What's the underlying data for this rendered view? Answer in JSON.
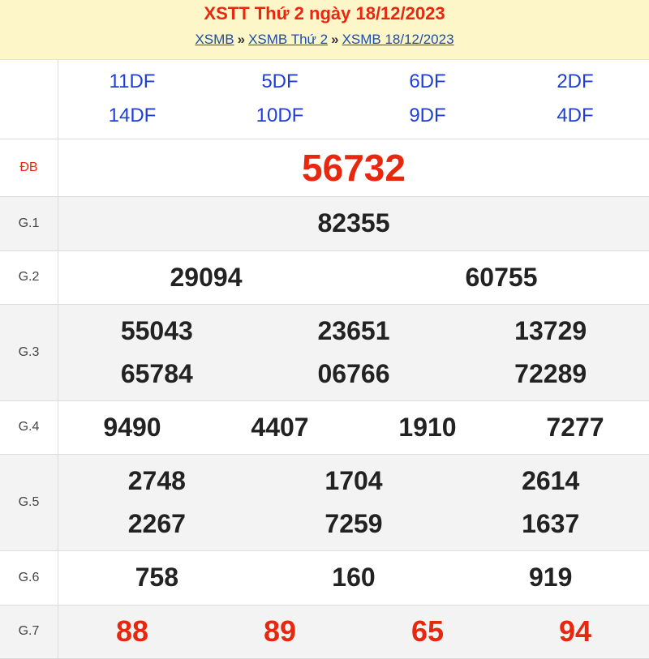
{
  "header": {
    "title": "XSTT Thứ 2 ngày 18/12/2023",
    "breadcrumb": [
      "XSMB",
      "XSMB Thứ 2",
      "XSMB 18/12/2023"
    ],
    "separator": "»"
  },
  "codes": [
    "11DF",
    "5DF",
    "6DF",
    "2DF",
    "14DF",
    "10DF",
    "9DF",
    "4DF"
  ],
  "prizes": {
    "db": {
      "label": "ĐB",
      "numbers": [
        "56732"
      ]
    },
    "g1": {
      "label": "G.1",
      "numbers": [
        "82355"
      ]
    },
    "g2": {
      "label": "G.2",
      "numbers": [
        "29094",
        "60755"
      ]
    },
    "g3": {
      "label": "G.3",
      "numbers": [
        "55043",
        "23651",
        "13729",
        "65784",
        "06766",
        "72289"
      ]
    },
    "g4": {
      "label": "G.4",
      "numbers": [
        "9490",
        "4407",
        "1910",
        "7277"
      ]
    },
    "g5": {
      "label": "G.5",
      "numbers": [
        "2748",
        "1704",
        "2614",
        "2267",
        "7259",
        "1637"
      ]
    },
    "g6": {
      "label": "G.6",
      "numbers": [
        "758",
        "160",
        "919"
      ]
    },
    "g7": {
      "label": "G.7",
      "numbers": [
        "88",
        "89",
        "65",
        "94"
      ]
    }
  },
  "colors": {
    "accent_red": "#e8270f",
    "code_blue": "#1e3fd6",
    "header_bg": "#fdf6c9",
    "alt_row": "#f3f3f3"
  }
}
